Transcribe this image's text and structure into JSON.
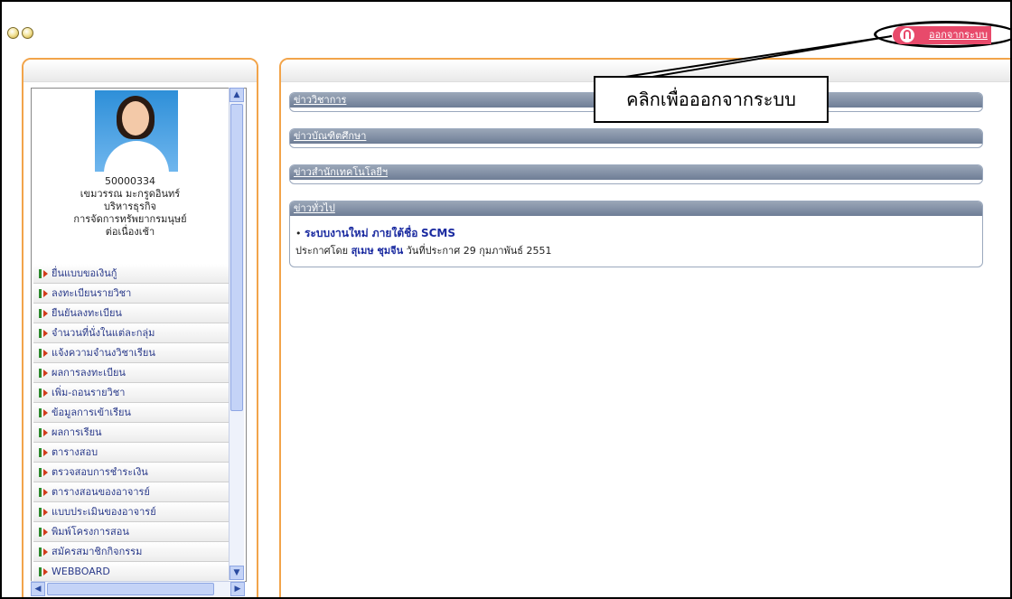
{
  "toolbar": {
    "icons": [
      "document-icon",
      "refresh-icon"
    ]
  },
  "logout": {
    "label": "ออกจากระบบ",
    "color": "#e84a6b"
  },
  "callout": {
    "text": "คลิกเพื่อออกจากระบบ"
  },
  "profile": {
    "student_id": "50000334",
    "name": "เขมวรรณ มะกรูดอินทร์",
    "faculty": "บริหารธุรกิจ",
    "major": "การจัดการทรัพยากรมนุษย์",
    "program": "ต่อเนื่องเช้า"
  },
  "menu": {
    "items": [
      "ยื่นแบบขอเงินกู้",
      "ลงทะเบียนรายวิชา",
      "ยืนยันลงทะเบียน",
      "จำนวนที่นั่งในแต่ละกลุ่ม",
      "แจ้งความจำนงวิชาเรียน",
      "ผลการลงทะเบียน",
      "เพิ่ม-ถอนรายวิชา",
      "ข้อมูลการเข้าเรียน",
      "ผลการเรียน",
      "ตารางสอบ",
      "ตรวจสอบการชำระเงิน",
      "ตารางสอนของอาจารย์",
      "แบบประเมินของอาจารย์",
      "พิมพ์โครงการสอน",
      "สมัครสมาชิกกิจกรรม",
      "WEBBOARD"
    ]
  },
  "news": {
    "sections": [
      {
        "title": "ข่าววิชาการ"
      },
      {
        "title": "ข่าวบัณฑิตศึกษา"
      },
      {
        "title": "ข่าวสำนักเทคโนโลยีฯ"
      },
      {
        "title": "ข่าวทั่วไป"
      }
    ],
    "general": {
      "headline_thai": "ระบบงานใหม่ ภายใต้ชื่อ",
      "headline_eng": "SCMS",
      "announced_by_label": "ประกาศโดย",
      "announced_by": "สุเมษ ชุมจีน",
      "date_label": "วันที่ประกาศ",
      "date": "29 กุมภาพันธ์ 2551"
    }
  },
  "colors": {
    "panel_border": "#f2a44a",
    "section_header": "#7a889f",
    "link": "#1a2aa0"
  }
}
